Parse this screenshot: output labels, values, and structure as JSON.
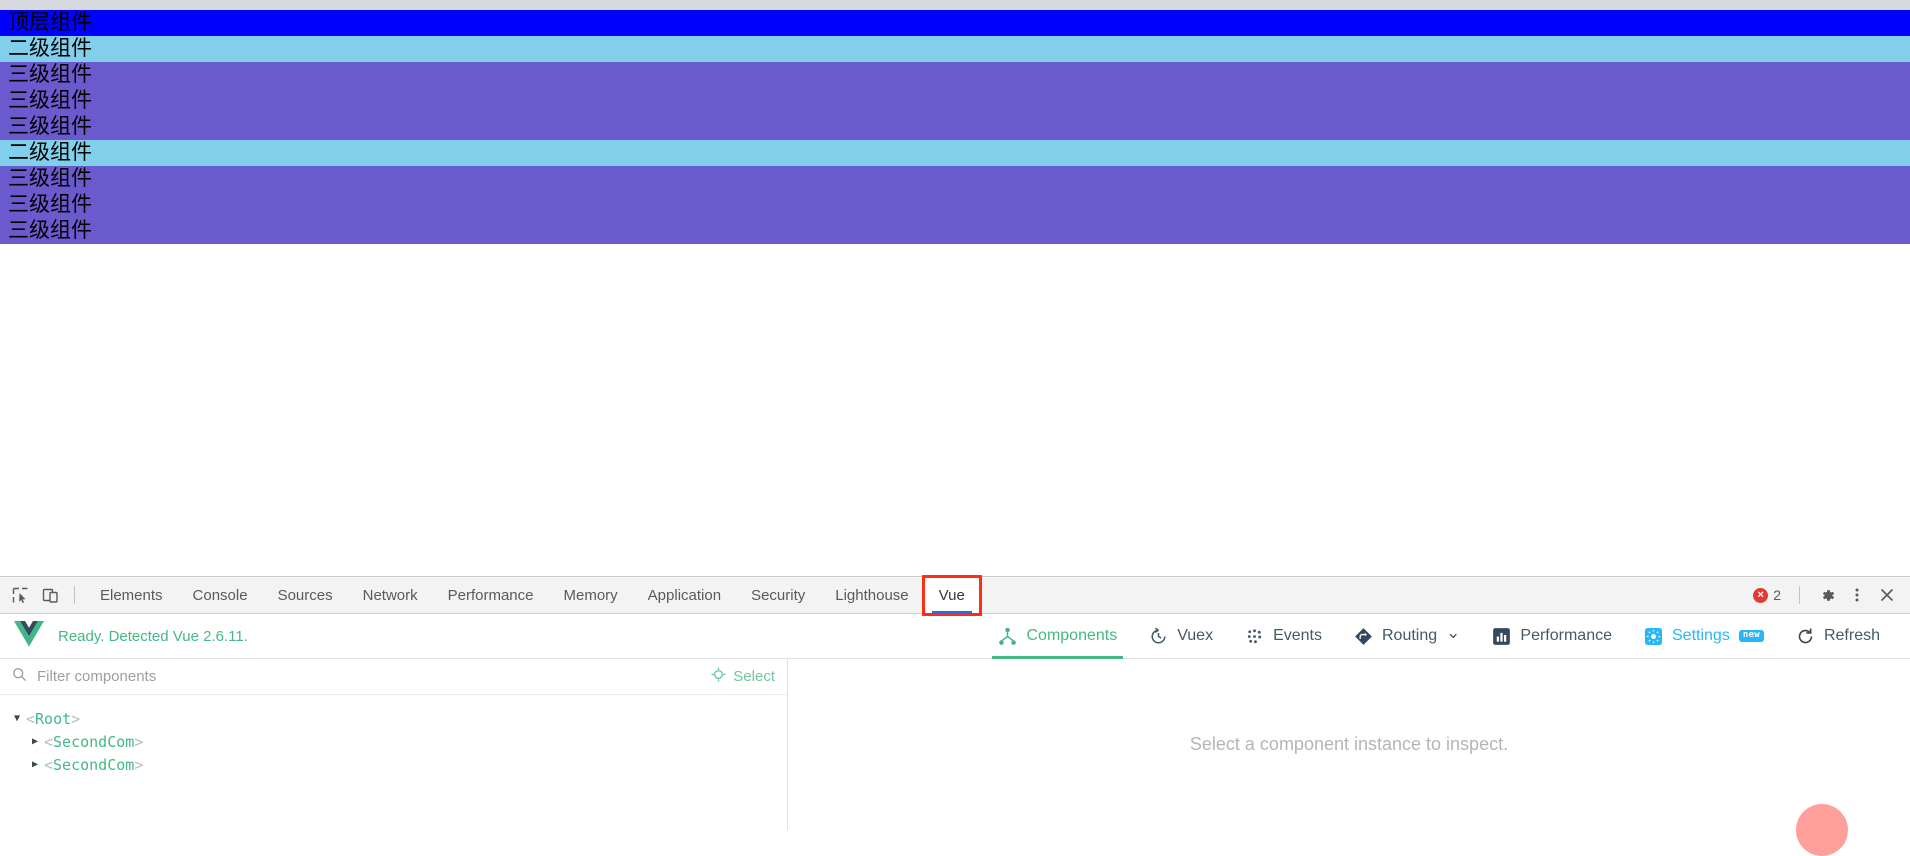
{
  "page": {
    "components": [
      {
        "label": "顶层组件",
        "level": "top"
      },
      {
        "label": "二级组件",
        "level": "second"
      },
      {
        "label": "三级组件",
        "level": "third"
      },
      {
        "label": "三级组件",
        "level": "third"
      },
      {
        "label": "三级组件",
        "level": "third"
      },
      {
        "label": "二级组件",
        "level": "second"
      },
      {
        "label": "三级组件",
        "level": "third"
      },
      {
        "label": "三级组件",
        "level": "third"
      },
      {
        "label": "三级组件",
        "level": "third"
      }
    ],
    "colors": {
      "top": "#0000ff",
      "second": "#82cfec",
      "third": "#6a5acd"
    }
  },
  "devtools": {
    "tools": [
      {
        "name": "inspect-element-icon"
      },
      {
        "name": "device-toolbar-icon"
      }
    ],
    "tabs": [
      {
        "label": "Elements",
        "active": false
      },
      {
        "label": "Console",
        "active": false
      },
      {
        "label": "Sources",
        "active": false
      },
      {
        "label": "Network",
        "active": false
      },
      {
        "label": "Performance",
        "active": false
      },
      {
        "label": "Memory",
        "active": false
      },
      {
        "label": "Application",
        "active": false
      },
      {
        "label": "Security",
        "active": false
      },
      {
        "label": "Lighthouse",
        "active": false
      },
      {
        "label": "Vue",
        "active": true,
        "annotated": true
      }
    ],
    "error_badge": {
      "symbol": "×",
      "count": "2"
    },
    "right_icons": [
      {
        "name": "settings-gear-icon"
      },
      {
        "name": "more-options-icon"
      },
      {
        "name": "close-devtools-icon"
      }
    ],
    "annotation_color": "#ff2d16",
    "active_tab_underline_color": "#1a73e8"
  },
  "vue": {
    "status": "Ready. Detected Vue 2.6.11.",
    "brand_color": "#42b983",
    "nav": [
      {
        "label": "Components",
        "icon": "components-tree-icon",
        "active": true
      },
      {
        "label": "Vuex",
        "icon": "history-clock-icon",
        "active": false
      },
      {
        "label": "Events",
        "icon": "events-dots-icon",
        "active": false
      },
      {
        "label": "Routing",
        "icon": "routing-diamond-icon",
        "active": false,
        "chevron": "⌄"
      },
      {
        "label": "Performance",
        "icon": "performance-bars-icon",
        "active": false
      },
      {
        "label": "Settings",
        "icon": "settings-gear-icon",
        "active": false,
        "badge": "new"
      },
      {
        "label": "Refresh",
        "icon": "refresh-icon",
        "active": false
      }
    ],
    "filter": {
      "placeholder": "Filter components",
      "value": "",
      "search_icon": "search-icon"
    },
    "select_button": {
      "label": "Select",
      "icon": "crosshair-target-icon",
      "color": "#6fc99b"
    },
    "tree": [
      {
        "arrow": "▼",
        "open": true,
        "name": "Root",
        "depth": 0
      },
      {
        "arrow": "▶",
        "open": false,
        "name": "SecondCom",
        "depth": 1
      },
      {
        "arrow": "▶",
        "open": false,
        "name": "SecondCom",
        "depth": 1
      }
    ],
    "bracket_open": "<",
    "bracket_close": ">",
    "detail_empty_message": "Select a component instance to inspect."
  }
}
